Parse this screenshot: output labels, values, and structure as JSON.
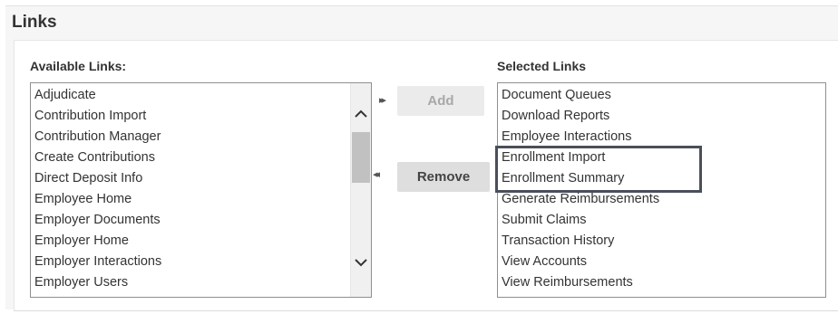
{
  "section": {
    "title": "Links"
  },
  "available": {
    "label": "Available Links:",
    "items": [
      "Adjudicate",
      "Contribution Import",
      "Contribution Manager",
      "Create Contributions",
      "Direct Deposit Info",
      "Employee Home",
      "Employer Documents",
      "Employer Home",
      "Employer Interactions",
      "Employer Users"
    ],
    "scroll_position": 0.3
  },
  "selected": {
    "label": "Selected Links",
    "items": [
      "Document Queues",
      "Download Reports",
      "Employee Interactions",
      "Enrollment Import",
      "Enrollment Summary",
      "Generate Reimbursements",
      "Submit Claims",
      "Transaction History",
      "View Accounts",
      "View Reimbursements"
    ],
    "highlighted": [
      "Enrollment Import",
      "Enrollment Summary"
    ]
  },
  "actions": {
    "add_label": "Add",
    "add_enabled": false,
    "remove_label": "Remove",
    "remove_enabled": true,
    "add_icon": "double-chevron-right-icon",
    "remove_icon": "double-chevron-left-icon"
  },
  "colors": {
    "highlight_border": "#4a4f5a",
    "scroll_thumb": "#c1c1c1"
  }
}
